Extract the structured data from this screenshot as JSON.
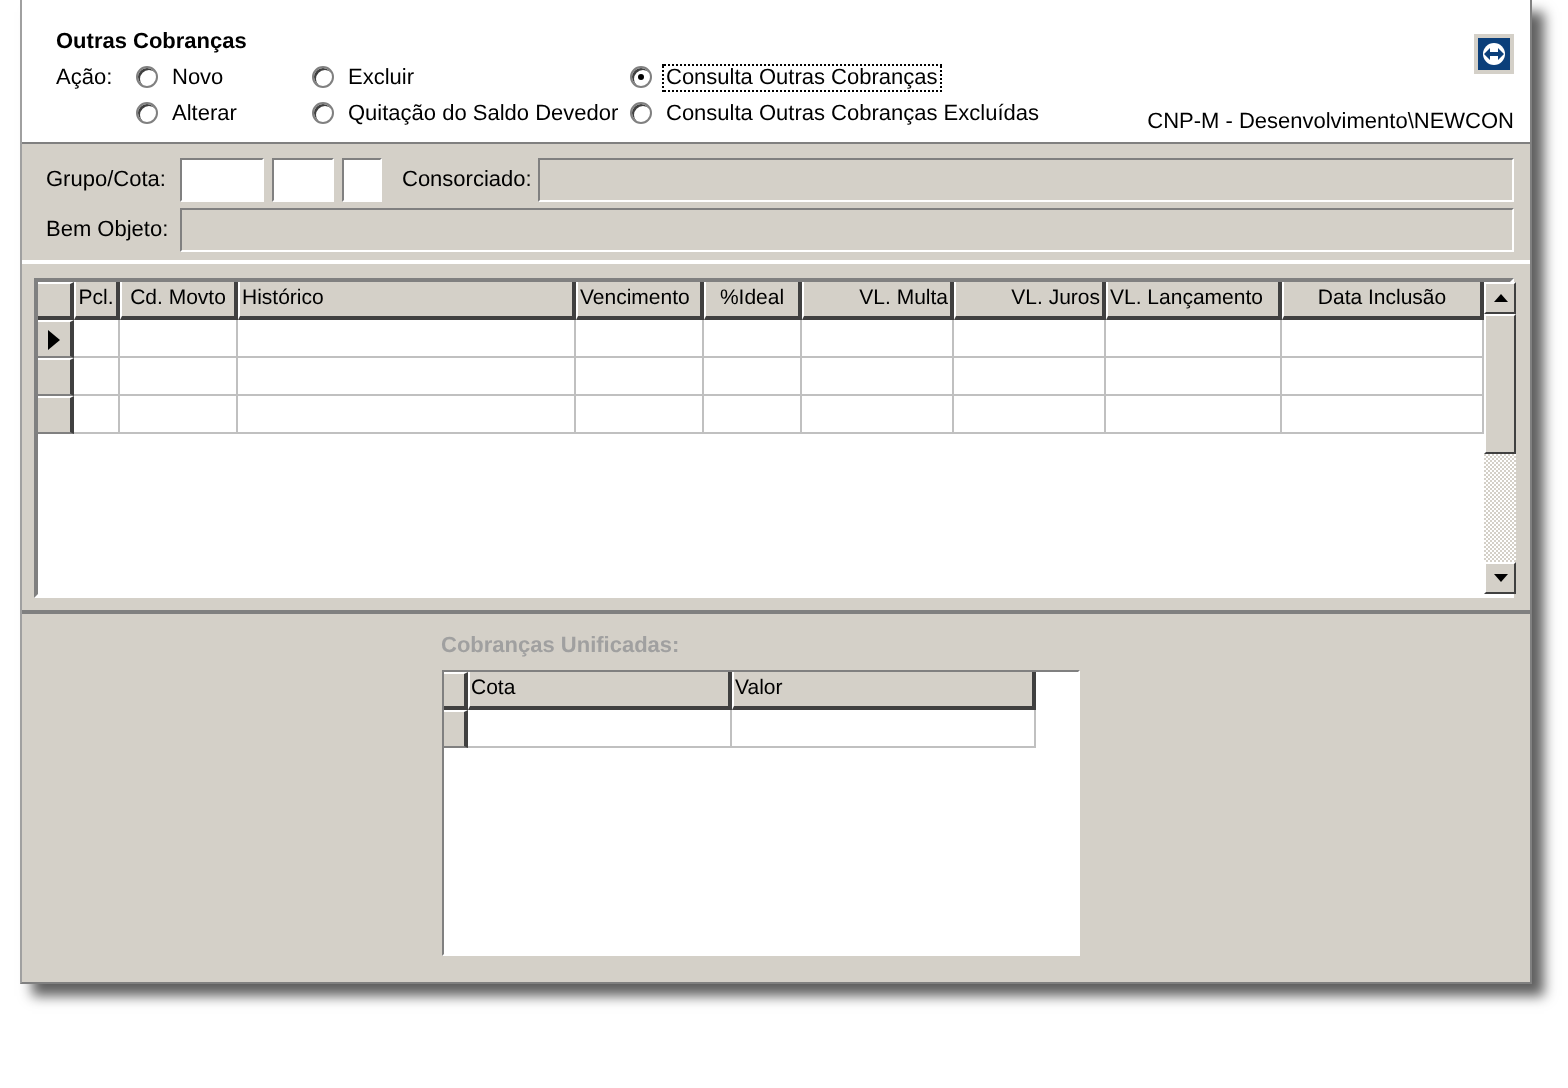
{
  "form": {
    "title": "Outras Cobranças",
    "action_label": "Ação:",
    "environment": "CNP-M - Desenvolvimento\\NEWCON"
  },
  "actions": [
    {
      "label": "Novo",
      "selected": false
    },
    {
      "label": "Alterar",
      "selected": false
    },
    {
      "label": "Excluir",
      "selected": false
    },
    {
      "label": "Quitação do Saldo Devedor",
      "selected": false
    },
    {
      "label": "Consulta Outras Cobranças",
      "selected": true
    },
    {
      "label": "Consulta Outras Cobranças Excluídas",
      "selected": false
    }
  ],
  "fields": {
    "grupo_cota_label": "Grupo/Cota:",
    "consorciado_label": "Consorciado:",
    "bem_objeto_label": "Bem Objeto:"
  },
  "table": {
    "columns": [
      {
        "label": "Pcl."
      },
      {
        "label": "Cd. Movto"
      },
      {
        "label": "Histórico"
      },
      {
        "label": "Vencimento"
      },
      {
        "label": "%Ideal"
      },
      {
        "label": "VL. Multa"
      },
      {
        "label": "VL. Juros"
      },
      {
        "label": "VL. Lançamento"
      },
      {
        "label": "Data Inclusão"
      }
    ],
    "rows": [
      {
        "selected": true
      },
      {
        "selected": false
      },
      {
        "selected": false
      }
    ]
  },
  "unified": {
    "title": "Cobranças Unificadas:",
    "disabled": true,
    "columns": [
      {
        "label": "Cota"
      },
      {
        "label": "Valor"
      }
    ],
    "rows": [
      {
        "selected": false
      }
    ]
  }
}
